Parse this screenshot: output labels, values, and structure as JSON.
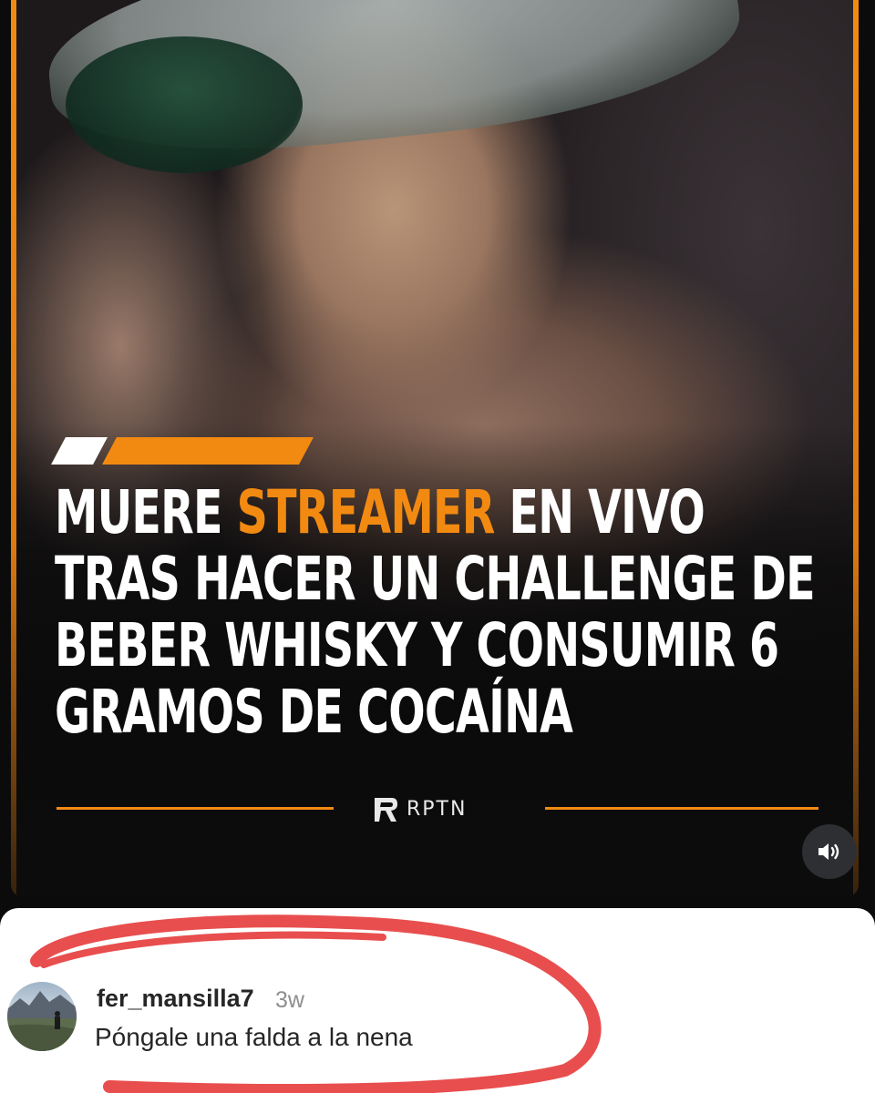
{
  "post": {
    "headline": {
      "part1": "MUERE ",
      "highlight": "STREAMER",
      "part2": " EN VIVO TRAS HACER UN CHALLENGE DE BEBER WHISKY Y CONSUMIR 6 GRAMOS DE COCAÍNA"
    },
    "brand": "RPTN",
    "sound_icon": "speaker-icon"
  },
  "comment": {
    "username": "fer_mansilla7",
    "time": "3w",
    "text": "Póngale una falda a la nena"
  },
  "colors": {
    "accent": "#f28a12",
    "background": "#0b0b0b",
    "annotation_red": "#e84e4e",
    "comment_bg": "#ffffff",
    "comment_text": "#262626",
    "muted_text": "#8e8e8e"
  }
}
